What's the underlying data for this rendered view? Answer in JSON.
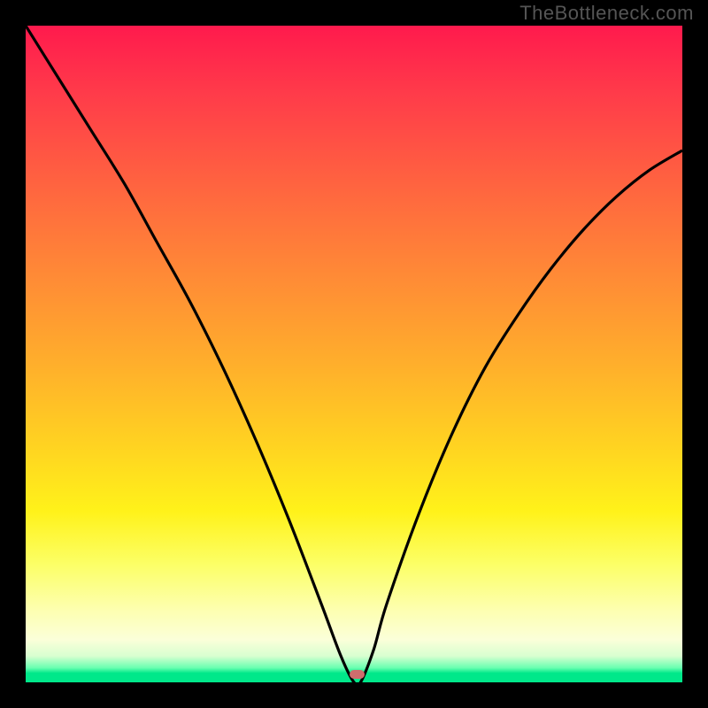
{
  "watermark": "TheBottleneck.com",
  "colors": {
    "curve_stroke": "#000000",
    "marker_fill": "#cf6d6d",
    "frame_border": "#000000"
  },
  "chart_data": {
    "type": "line",
    "title": "",
    "xlabel": "",
    "ylabel": "",
    "xlim": [
      0,
      100
    ],
    "ylim": [
      0,
      100
    ],
    "x": [
      0,
      5,
      10,
      15,
      20,
      25,
      30,
      35,
      40,
      45,
      48,
      50,
      51,
      53,
      55,
      60,
      65,
      70,
      75,
      80,
      85,
      90,
      95,
      100
    ],
    "values": [
      100,
      92,
      84,
      76,
      67,
      58,
      48,
      37,
      25,
      12,
      4,
      0,
      0,
      5,
      12,
      26,
      38,
      48,
      56,
      63,
      69,
      74,
      78,
      81
    ],
    "minimum": {
      "x": 50.5,
      "y": 0
    },
    "note": "Values estimated from pixel positions; y=0 is bottom (green), y=100 is top (red)."
  }
}
